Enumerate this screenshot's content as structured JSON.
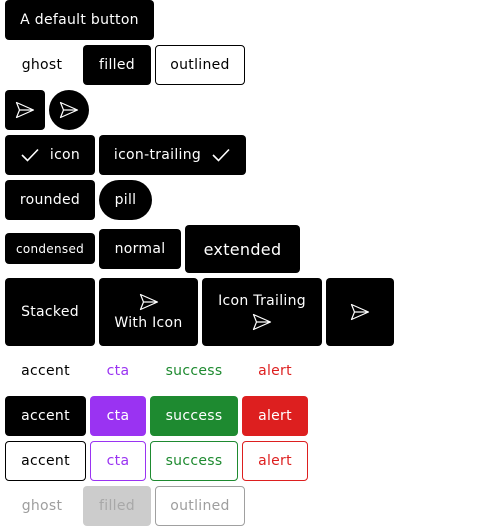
{
  "colors": {
    "black": "#000000",
    "white": "#ffffff",
    "accent": "#000000",
    "cta": "#9a33f2",
    "success": "#1e8a30",
    "alert": "#dd1f1f",
    "disabled_bg": "#cccccc",
    "disabled_text": "#9e9e9e",
    "disabled_border": "#a0a0a0"
  },
  "icons": {
    "send": "send-icon",
    "check": "check-icon"
  },
  "buttons": {
    "default": "A default button",
    "ghost": "ghost",
    "filled": "filled",
    "outlined": "outlined",
    "icon": "icon",
    "icon_trailing": "icon-trailing",
    "rounded": "rounded",
    "pill": "pill",
    "condensed": "condensed",
    "normal": "normal",
    "extended": "extended",
    "stacked": "Stacked",
    "with_icon": "With Icon",
    "icon_trailing_stacked": "Icon Trailing"
  },
  "variants": {
    "accent": "accent",
    "cta": "cta",
    "success": "success",
    "alert": "alert"
  },
  "disabled": {
    "ghost": "ghost",
    "filled": "filled",
    "outlined": "outlined"
  }
}
